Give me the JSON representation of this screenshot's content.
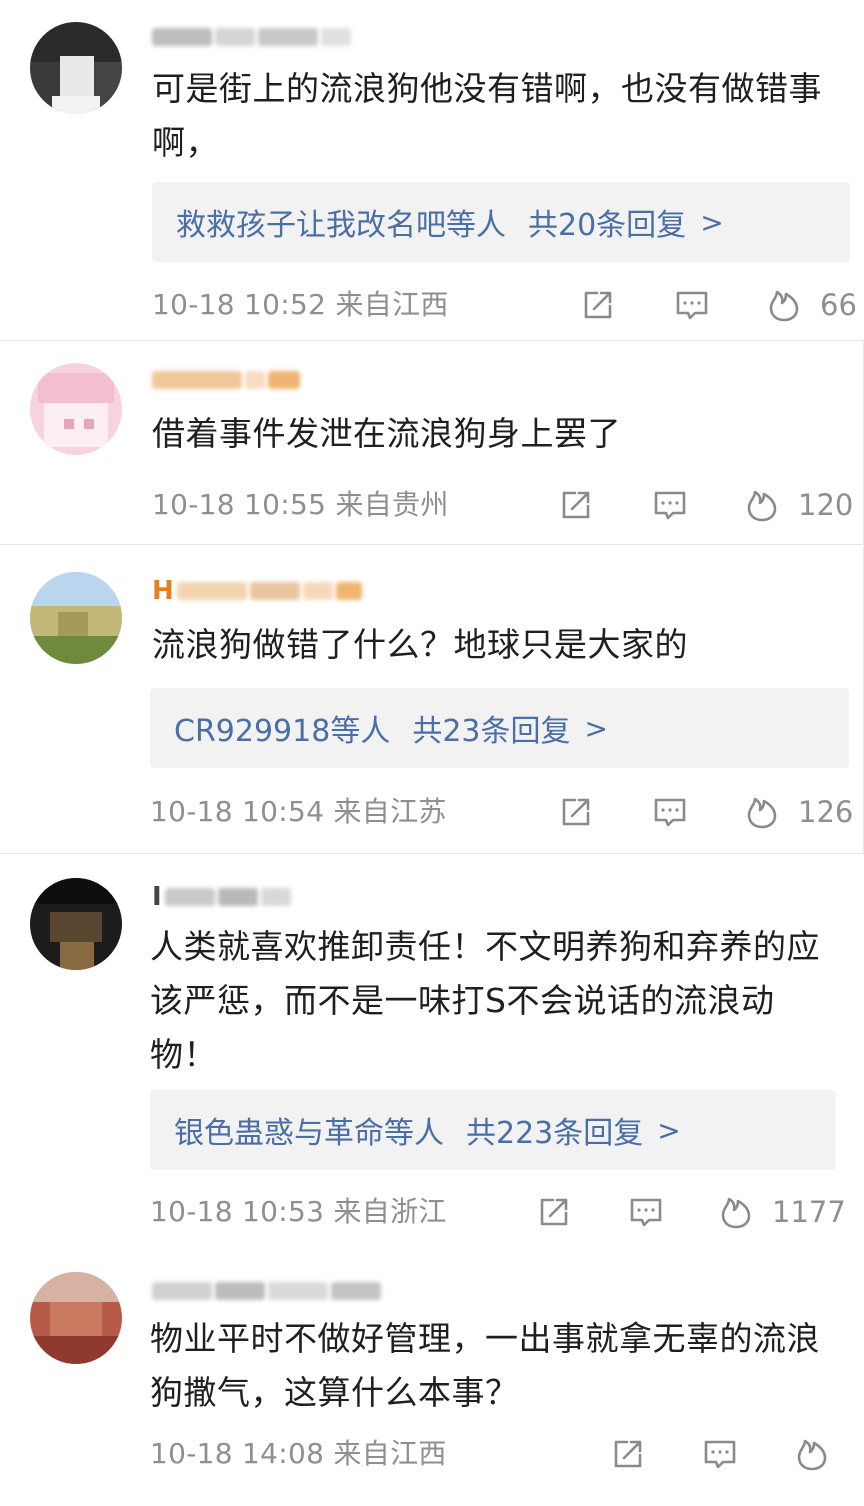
{
  "comments": [
    {
      "text": "可是街上的流浪狗他没有错啊，也没有做错事啊，",
      "reply_users": "救救孩子让我改名吧等人",
      "reply_count": "共20条回复",
      "time": "10-18 10:52",
      "location": "来自江西",
      "likes": "66"
    },
    {
      "text": "借着事件发泄在流浪狗身上罢了",
      "time": "10-18 10:55",
      "location": "来自贵州",
      "likes": "120"
    },
    {
      "name_initial": "H",
      "text": "流浪狗做错了什么？地球只是大家的",
      "reply_users": "CR929918等人",
      "reply_count": "共23条回复",
      "time": "10-18 10:54",
      "location": "来自江苏",
      "likes": "126"
    },
    {
      "text": "人类就喜欢推卸责任！不文明养狗和弃养的应该严惩，而不是一味打S不会说话的流浪动物！",
      "reply_users": "银色蛊惑与革命等人",
      "reply_count": "共223条回复",
      "time": "10-18 10:53",
      "location": "来自浙江",
      "likes": "1177"
    },
    {
      "text": "物业平时不做好管理，一出事就拿无辜的流浪狗撒气，这算什么本事？",
      "time": "10-18 14:08",
      "location": "来自江西",
      "likes": ""
    }
  ],
  "colors": {
    "link": "#4a6fa5",
    "meta": "#8f8f8f",
    "reply_bg": "#f2f2f2"
  },
  "icons": [
    "share-icon",
    "comment-icon",
    "like-flame-icon",
    "chevron-right-icon"
  ]
}
